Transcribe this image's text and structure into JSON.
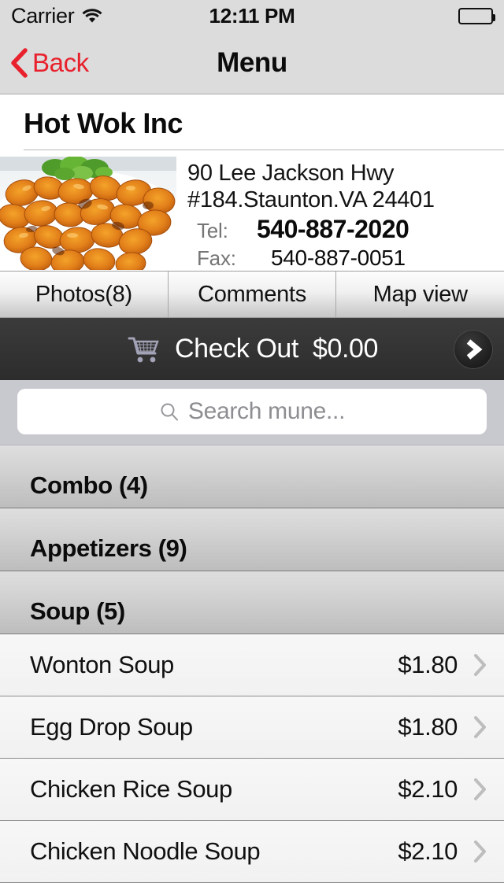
{
  "status_bar": {
    "carrier": "Carrier",
    "wifi_icon": "wifi-icon",
    "time": "12:11 PM",
    "battery_icon": "battery-full-icon"
  },
  "nav_bar": {
    "back_icon": "chevron-left-icon",
    "back_label": "Back",
    "title": "Menu"
  },
  "restaurant": {
    "name": "Hot Wok Inc",
    "photo_alt": "orange-chicken-dish-photo",
    "address_line1": "90 Lee Jackson Hwy",
    "address_line2": "#184.Staunton.VA 24401",
    "tel_label": "Tel:",
    "tel_value": "540-887-2020",
    "fax_label": "Fax:",
    "fax_value": "540-887-0051"
  },
  "tabs": [
    {
      "label": "Photos(8)"
    },
    {
      "label": "Comments"
    },
    {
      "label": "Map view"
    }
  ],
  "checkout": {
    "cart_icon": "shopping-cart-icon",
    "label": "Check Out",
    "total": "$0.00",
    "arrow_icon": "chevron-right-circle-icon"
  },
  "search": {
    "icon": "search-icon",
    "placeholder": "Search mune...",
    "value": ""
  },
  "menu": {
    "sections": [
      {
        "title": "Combo (4)",
        "items": []
      },
      {
        "title": "Appetizers (9)",
        "items": []
      },
      {
        "title": "Soup (5)",
        "items": [
          {
            "name": "Wonton Soup",
            "price": "$1.80"
          },
          {
            "name": "Egg Drop Soup",
            "price": "$1.80"
          },
          {
            "name": "Chicken Rice Soup",
            "price": "$2.10"
          },
          {
            "name": "Chicken Noodle Soup",
            "price": "$2.10"
          }
        ]
      }
    ]
  },
  "colors": {
    "accent_red": "#e8212c",
    "status_bar_bg": "#dcdcdc",
    "checkout_bg": "#343434",
    "search_bar_bg": "#c8c8cf",
    "cart_icon": "#a3a3b8"
  }
}
